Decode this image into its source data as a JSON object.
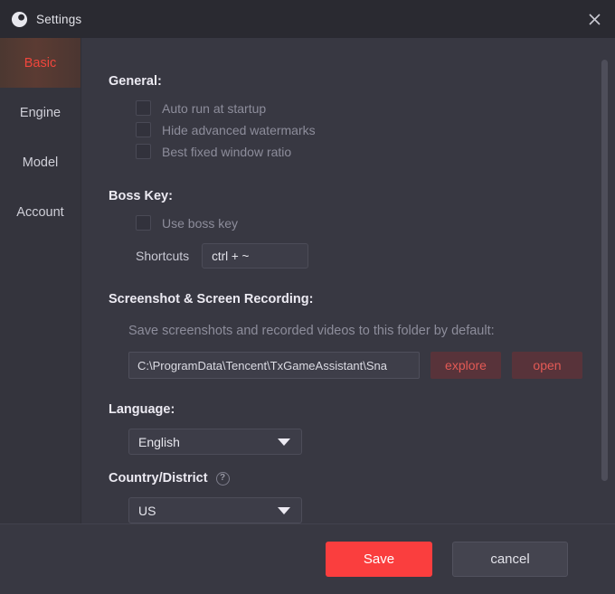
{
  "window": {
    "title": "Settings",
    "logo_icon": "app-logo-icon",
    "close_icon": "close-icon"
  },
  "sidebar": {
    "items": [
      {
        "label": "Basic",
        "active": true
      },
      {
        "label": "Engine",
        "active": false
      },
      {
        "label": "Model",
        "active": false
      },
      {
        "label": "Account",
        "active": false
      }
    ]
  },
  "main": {
    "general": {
      "title": "General:",
      "checkboxes": [
        {
          "label": "Auto run at startup",
          "checked": false
        },
        {
          "label": "Hide advanced watermarks",
          "checked": false
        },
        {
          "label": "Best fixed window ratio",
          "checked": false
        }
      ]
    },
    "boss_key": {
      "title": "Boss Key:",
      "checkbox": {
        "label": "Use boss key",
        "checked": false
      },
      "shortcuts_label": "Shortcuts",
      "shortcuts_value": "ctrl + ~"
    },
    "screenshot": {
      "title": "Screenshot & Screen Recording:",
      "description": "Save screenshots and recorded videos to this folder by default:",
      "path_value": "C:\\ProgramData\\Tencent\\TxGameAssistant\\Sna",
      "explore_label": "explore",
      "open_label": "open"
    },
    "language": {
      "title": "Language:",
      "selected": "English"
    },
    "country": {
      "title": "Country/District",
      "help_icon": "help-circle-icon",
      "selected": "US"
    }
  },
  "footer": {
    "save_label": "Save",
    "cancel_label": "cancel"
  },
  "colors": {
    "accent_red": "#fa3e3e",
    "active_tab_text": "#f0463c",
    "window_bg": "#383842",
    "titlebar_bg": "#2a2a31",
    "sidebar_bg": "#34343d"
  }
}
